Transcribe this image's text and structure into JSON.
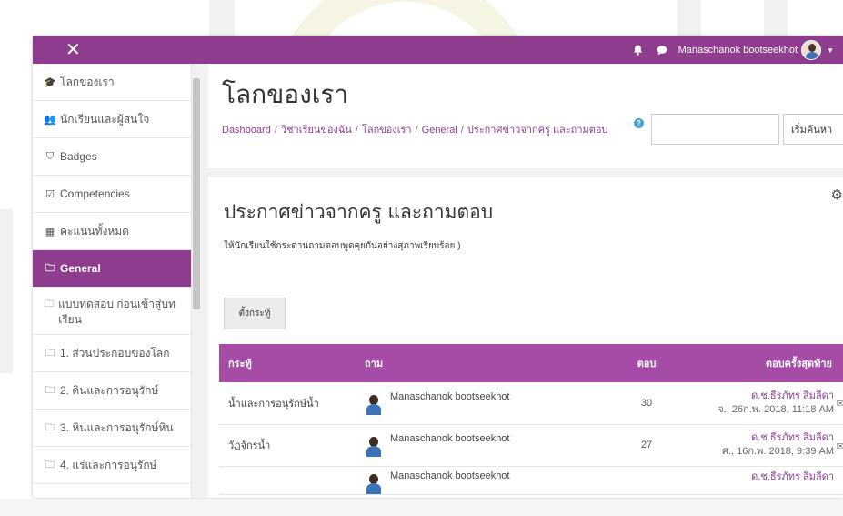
{
  "navbar": {
    "close_glyph": "✕",
    "bell_glyph": "🔔",
    "chat_glyph": "💬",
    "username": "Manaschanok bootseekhot",
    "caret": "▼",
    "bg_color": "#8e3d8e"
  },
  "sidebar": {
    "items": [
      {
        "icon": "graduation-cap-icon",
        "glyph": "🎓",
        "label": "โลกของเรา"
      },
      {
        "icon": "users-icon",
        "glyph": "👥",
        "label": "นักเรียนและผู้สนใจ"
      },
      {
        "icon": "shield-icon",
        "glyph": "⛉",
        "label": "Badges"
      },
      {
        "icon": "checkbox-icon",
        "glyph": "☑",
        "label": "Competencies"
      },
      {
        "icon": "grid-icon",
        "glyph": "▦",
        "label": "คะแนนทั้งหมด"
      },
      {
        "icon": "folder-icon",
        "glyph": "🗀",
        "label": "General"
      },
      {
        "icon": "folder-icon",
        "glyph": "🗀",
        "label": "แบบทดสอบ ก่อนเข้าสู่บทเรียน"
      },
      {
        "icon": "folder-icon",
        "glyph": "🗀",
        "label": "1. ส่วนประกอบของโลก"
      },
      {
        "icon": "folder-icon",
        "glyph": "🗀",
        "label": "2. ดินและการอนุรักษ์"
      },
      {
        "icon": "folder-icon",
        "glyph": "🗀",
        "label": "3. หินและการอนุรักษ์หิน"
      },
      {
        "icon": "folder-icon",
        "glyph": "🗀",
        "label": "4. แร่และการอนุรักษ์"
      }
    ]
  },
  "header": {
    "title": "โลกของเรา",
    "breadcrumb": [
      "Dashboard",
      "วิชาเรียนของฉัน",
      "โลกของเรา",
      "General",
      "ประกาศข่าวจากครู และถามตอบ"
    ],
    "breadcrumb_sep": "/",
    "help_glyph": "?",
    "search_placeholder": "",
    "search_button": "เริ่มค้นหา"
  },
  "forum": {
    "settings_glyph": "⚙",
    "title": "ประกาศข่าวจากครู และถามตอบ",
    "intro": "ให้นักเรียนใช้กระดานถามตอบพูดคุยกันอย่างสุภาพเรียบร้อย )",
    "add_button": "ตั้งกระทู้",
    "columns": {
      "topic": "กระทู้",
      "started_by": "ถาม",
      "replies": "ตอบ",
      "last_post": "ตอบครั้งสุดท้าย"
    },
    "rows": [
      {
        "topic": "น้ำและการอนุรักษ์น้ำ",
        "user": "Manaschanok bootseekhot",
        "replies": "30",
        "last_name": "ด.ช.ธีรภัทร สิมลีดา",
        "last_date": "จ., 26ก.พ. 2018, 11:18 AM"
      },
      {
        "topic": "วัฏจักรน้ำ",
        "user": "Manaschanok bootseekhot",
        "replies": "27",
        "last_name": "ด.ช.ธีรภัทร สิมลีดา",
        "last_date": "ศ., 16ก.พ. 2018, 9:39 AM"
      },
      {
        "topic": "",
        "user": "Manaschanok bootseekhot",
        "replies": "",
        "last_name": "ด.ช.ธีรภัทร สิมลีดา",
        "last_date": ""
      }
    ],
    "mail_glyph": "✉",
    "header_color": "#a64ca6"
  }
}
